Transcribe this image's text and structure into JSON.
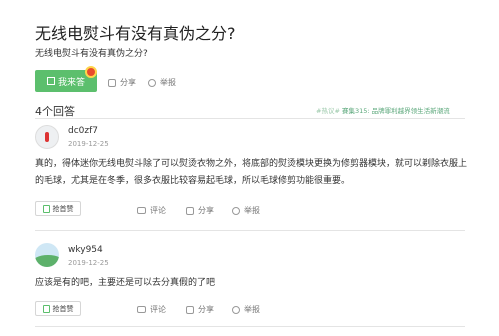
{
  "question": {
    "title": "无线电熨斗有没有真伪之分?",
    "description": "无线电熨斗有没有真伪之分?",
    "answer_button": "我来答",
    "share": "分享",
    "report": "举报"
  },
  "answers_header": {
    "count_label": "4个回答",
    "hot_prefix": "#热议#",
    "hot_text": "賽集315: 品牌罪利越界领生活新潮流"
  },
  "answers": [
    {
      "username": "dc0zf7",
      "date": "2019-12-25",
      "content": "真的，得体迷你无线电熨斗除了可以熨烫衣物之外，将底部的熨烫模块更换为修剪器模块，就可以剃除衣服上的毛球，尤其是在冬季，很多衣服比较容易起毛球，所以毛球修剪功能很重要。",
      "like": "抢首赞",
      "comment": "评论",
      "share": "分享",
      "report": "举报"
    },
    {
      "username": "wky954",
      "date": "2019-12-25",
      "content": "应该是有的吧，主要还是可以去分真假的了吧",
      "like": "抢首赞",
      "comment": "评论",
      "share": "分享",
      "report": "举报"
    }
  ],
  "colors": {
    "accent": "#5cbf6d",
    "badge": "#e84b2c",
    "hot": "#5aa77a"
  }
}
